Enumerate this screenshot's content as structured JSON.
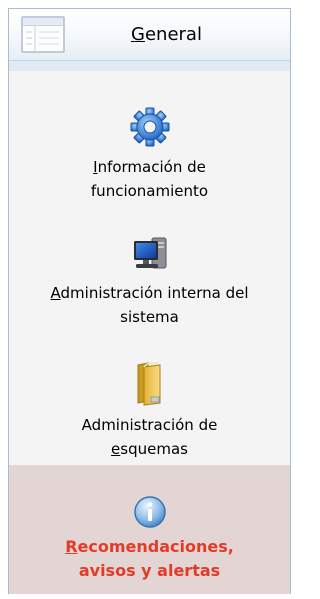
{
  "header": {
    "label": "General",
    "icon": "window-icon"
  },
  "items": [
    {
      "icon": "gear-icon",
      "line1": "Información de",
      "line2": "funcionamiento"
    },
    {
      "icon": "computer-icon",
      "line1": "Administración interna del",
      "line2": "sistema"
    },
    {
      "icon": "folder-icon",
      "line1": "Administración de",
      "line2": "esquemas"
    },
    {
      "icon": "info-icon",
      "line1": "Recomendaciones,",
      "line2": "avisos y alertas",
      "active": true,
      "text_color": "#e33b28"
    }
  ]
}
